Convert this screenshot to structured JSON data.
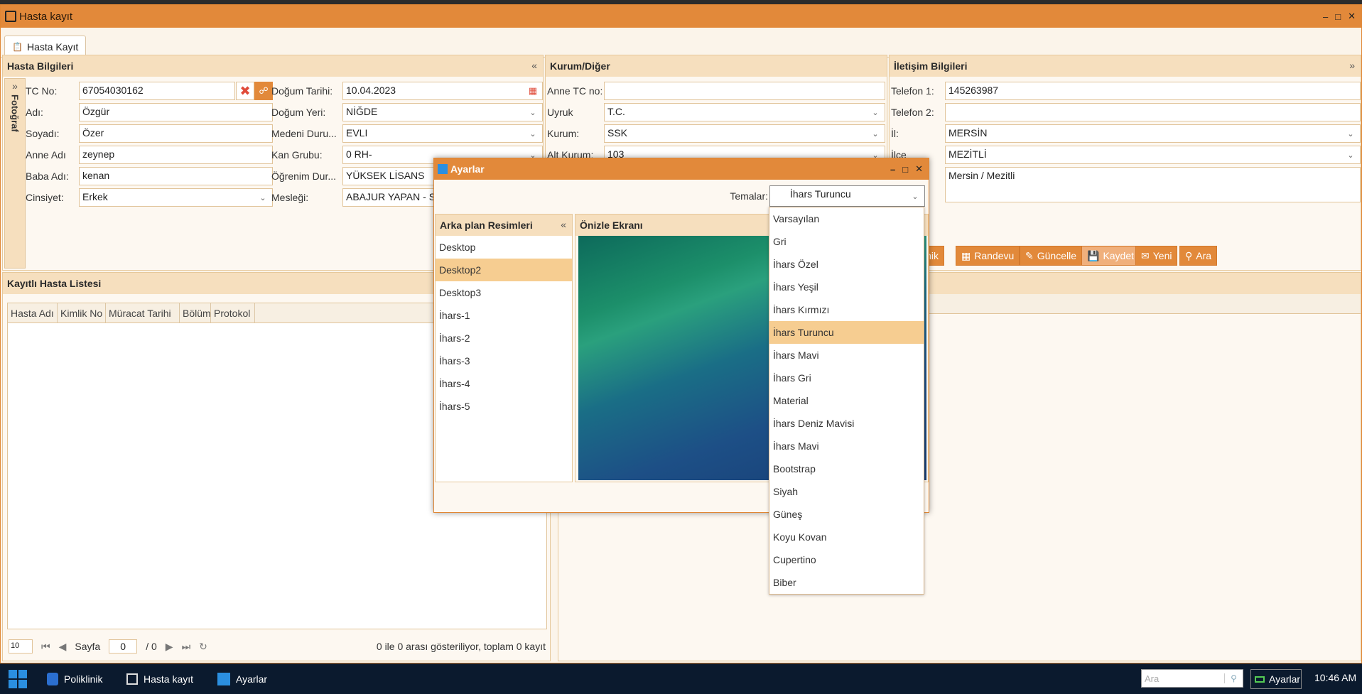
{
  "window": {
    "title": "Hasta kayıt",
    "tab_label": "Hasta Kayıt"
  },
  "hasta": {
    "header": "Hasta Bilgileri",
    "photo_label": "Fotoğraf",
    "tc_label": "TC No:",
    "tc": "67054030162",
    "adi_label": "Adı:",
    "adi": "Özgür",
    "soyadi_label": "Soyadı:",
    "soyadi": "Özer",
    "anne_label": "Anne Adı",
    "anne": "zeynep",
    "baba_label": "Baba Adı:",
    "baba": "kenan",
    "cinsiyet_label": "Cinsiyet:",
    "cinsiyet": "Erkek",
    "dogum_tarihi_label": "Doğum Tarihi:",
    "dogum_tarihi": "10.04.2023",
    "dogum_yeri_label": "Doğum Yeri:",
    "dogum_yeri": "NİĞDE",
    "medeni_label": "Medeni Duru...",
    "medeni": "EVLI",
    "kan_label": "Kan Grubu:",
    "kan": "0 RH-",
    "ogrenim_label": "Öğrenim Dur...",
    "ogrenim": "YÜKSEK LİSANS",
    "meslek_label": "Mesleği:",
    "meslek": "ABAJUR YAPAN - SER"
  },
  "kurum": {
    "header": "Kurum/Diğer",
    "anne_tc_label": "Anne TC no:",
    "anne_tc": "",
    "uyruk_label": "Uyruk",
    "uyruk": "T.C.",
    "kurum_label": "Kurum:",
    "kurum": "SSK",
    "alt_kurum_label": "Alt Kurum:",
    "alt_kurum": "103"
  },
  "iletisim": {
    "header": "İletişim Bilgileri",
    "tel1_label": "Telefon 1:",
    "tel1": "145263987",
    "tel2_label": "Telefon 2:",
    "tel2": "",
    "il_label": "İl:",
    "il": "MERSİN",
    "ilce_label": "İlçe",
    "ilce": "MEZİTLİ",
    "adres": "Mersin / Mezitli"
  },
  "actions": {
    "poliklinik": "inik",
    "randevu": "Randevu",
    "guncelle": "Güncelle",
    "kaydet": "Kaydet",
    "yeni": "Yeni",
    "ara": "Ara"
  },
  "list": {
    "header": "Kayıtlı Hasta Listesi",
    "columns": [
      "Hasta Adı",
      "Kimlik No",
      "Müracat Tarihi",
      "Bölüm",
      "Protokol"
    ],
    "page_size": "10",
    "page_label": "Sayfa",
    "page": "0",
    "of": "/ 0",
    "summary": "0 ile 0 arası gösteriliyor, toplam 0 kayıt"
  },
  "dialog": {
    "title": "Ayarlar",
    "themes_label": "Temalar:",
    "theme_selected": "İhars Turuncu",
    "bg_header": "Arka plan Resimleri",
    "preview_header": "Önizle Ekranı",
    "backgrounds": [
      "Desktop",
      "Desktop2",
      "Desktop3",
      "İhars-1",
      "İhars-2",
      "İhars-3",
      "İhars-4",
      "İhars-5"
    ],
    "bg_selected_index": 1,
    "themes": [
      "Varsayılan",
      "Gri",
      "İhars Özel",
      "İhars Yeşil",
      "İhars Kırmızı",
      "İhars Turuncu",
      "İhars Mavi",
      "İhars Gri",
      "Material",
      "İhars Deniz Mavisi",
      "İhars Mavi",
      "Bootstrap",
      "Siyah",
      "Güneş",
      "Koyu Kovan",
      "Cupertino",
      "Biber"
    ],
    "theme_selected_index": 5
  },
  "taskbar": {
    "items": [
      "Poliklinik",
      "Hasta kayıt",
      "Ayarlar"
    ],
    "search_placeholder": "Ara",
    "tray_label": "Ayarlar",
    "time": "10:46 AM"
  },
  "colors": {
    "accent": "#e2893a",
    "panel_header": "#f6dfbe",
    "selection": "#f6cd91",
    "taskbar": "#0b1a2e"
  }
}
